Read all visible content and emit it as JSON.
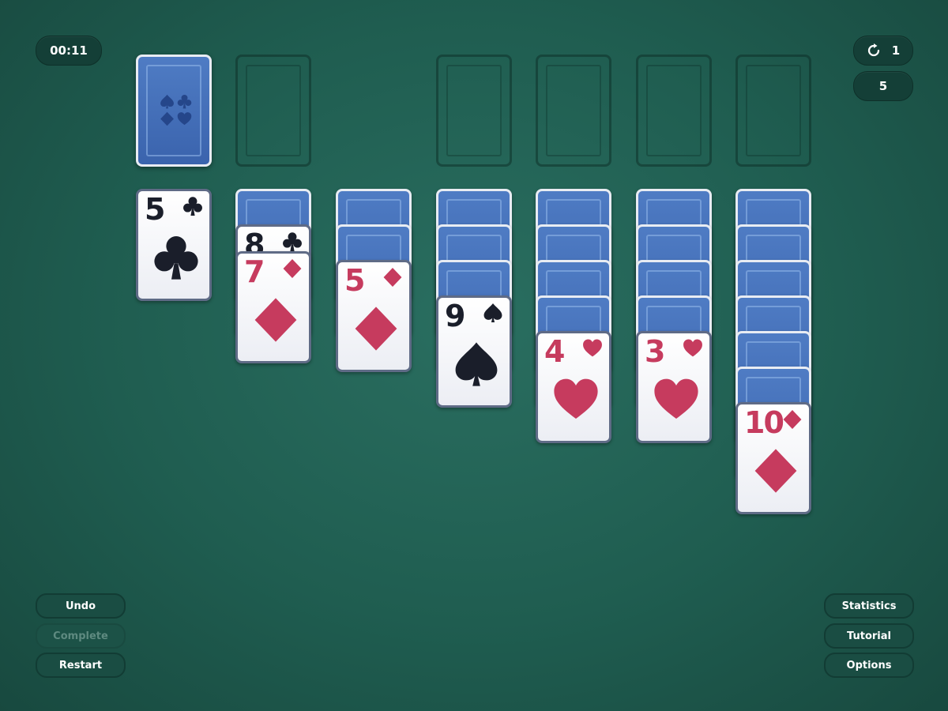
{
  "hud": {
    "timer": "00:11",
    "redeals": "1",
    "moves": "5"
  },
  "buttons": {
    "undo": "Undo",
    "complete": "Complete",
    "restart": "Restart",
    "statistics": "Statistics",
    "tutorial": "Tutorial",
    "options": "Options"
  },
  "icons": {
    "redeal": "refresh-icon",
    "suits": [
      "spade-icon",
      "club-icon",
      "diamond-icon",
      "heart-icon"
    ]
  },
  "colors": {
    "felt": "#1f5d50",
    "card_back": "#3a63ad",
    "red_suit": "#c63b5e",
    "black_suit": "#1a1e2a"
  },
  "tableau": [
    {
      "hidden": 0,
      "face": [
        {
          "rank": "5",
          "suit": "club"
        }
      ]
    },
    {
      "hidden": 1,
      "face": [
        {
          "rank": "8",
          "suit": "club"
        },
        {
          "rank": "7",
          "suit": "diamond"
        }
      ]
    },
    {
      "hidden": 2,
      "face": [
        {
          "rank": "5",
          "suit": "diamond"
        }
      ]
    },
    {
      "hidden": 3,
      "face": [
        {
          "rank": "9",
          "suit": "spade"
        }
      ]
    },
    {
      "hidden": 4,
      "face": [
        {
          "rank": "4",
          "suit": "heart"
        }
      ]
    },
    {
      "hidden": 4,
      "face": [
        {
          "rank": "3",
          "suit": "heart"
        }
      ]
    },
    {
      "hidden": 6,
      "face": [
        {
          "rank": "10",
          "suit": "diamond"
        }
      ]
    }
  ]
}
